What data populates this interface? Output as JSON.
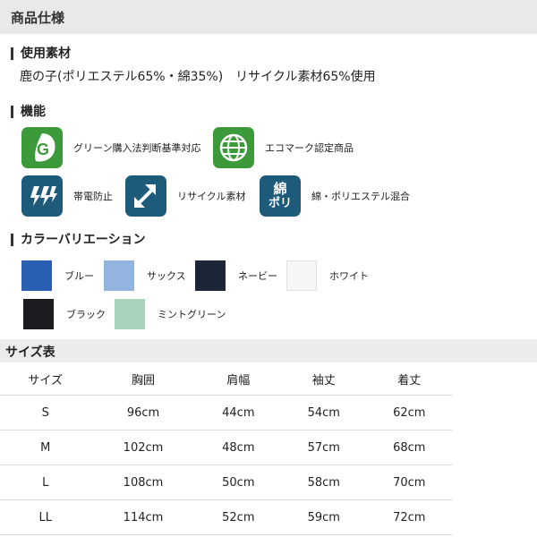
{
  "header": {
    "title": "商品仕様"
  },
  "material": {
    "heading": "使用素材",
    "text": "鹿の子(ポリエステル65%・綿35%)　リサイクル素材65%使用"
  },
  "functions": {
    "heading": "機能",
    "items": [
      {
        "icon": "green-purchase-g-icon",
        "label": "グリーン購入法判断基準対応",
        "color": "#3d9a3a"
      },
      {
        "icon": "eco-mark-globe-icon",
        "label": "エコマーク認定商品",
        "color": "#3d9a3a"
      },
      {
        "icon": "antistatic-icon",
        "label": "帯電防止",
        "color": "#1e5a7a"
      },
      {
        "icon": "recycle-arrows-icon",
        "label": "リサイクル素材",
        "color": "#1e5a7a"
      },
      {
        "icon": "cotton-poly-icon",
        "label": "綿・ポリエステル混合",
        "color": "#1e5a7a",
        "text_top": "綿",
        "text_bottom": "ポリ"
      }
    ]
  },
  "colors": {
    "heading": "カラーバリエーション",
    "items": [
      {
        "name": "ブルー",
        "hex": "#2b5fb4"
      },
      {
        "name": "サックス",
        "hex": "#93b4df"
      },
      {
        "name": "ネービー",
        "hex": "#1c2638"
      },
      {
        "name": "ホワイト",
        "hex": "#f6f6f6"
      },
      {
        "name": "ブラック",
        "hex": "#1a1c20"
      },
      {
        "name": "ミントグリーン",
        "hex": "#a8d4bc"
      }
    ]
  },
  "size_table": {
    "title": "サイズ表",
    "headers": [
      "サイズ",
      "胸囲",
      "肩幅",
      "袖丈",
      "着丈"
    ],
    "rows": [
      [
        "S",
        "96cm",
        "44cm",
        "54cm",
        "62cm"
      ],
      [
        "M",
        "102cm",
        "48cm",
        "57cm",
        "68cm"
      ],
      [
        "L",
        "108cm",
        "50cm",
        "58cm",
        "70cm"
      ],
      [
        "LL",
        "114cm",
        "52cm",
        "59cm",
        "72cm"
      ]
    ]
  }
}
